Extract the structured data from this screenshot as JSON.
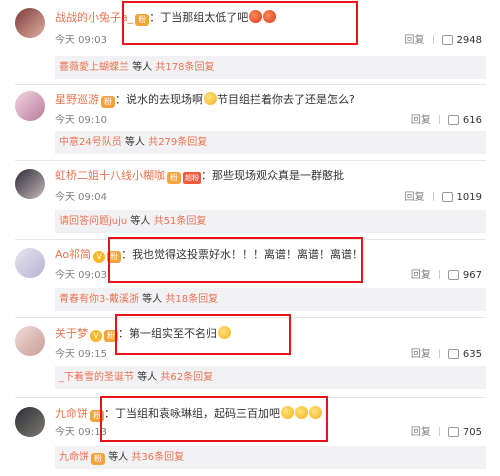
{
  "like_icon": "thumb-up-icon",
  "reply_label": "回复",
  "comments": [
    {
      "user": "战战的小兔子a_",
      "text": "丁当那组太低了吧",
      "emojis": 2,
      "time": "今天 09:03",
      "likes": "2948",
      "reply_users": "薔薇愛上蝴蝶兰",
      "reply_mid": "等人",
      "reply_count": "共178条回复"
    },
    {
      "user": "星野巡游",
      "text": "说水的去现场啊",
      "text2": "节目组拦着你去了还是怎么?",
      "time": "今天 09:10",
      "likes": "616",
      "reply_users": "中意24号队员",
      "reply_mid": "等人",
      "reply_count": "共279条回复"
    },
    {
      "user": "虹桥二姐十八线小糊咖",
      "vip": "超粉",
      "text": "那些现场观众真是一群憨批",
      "time": "今天 09:04",
      "likes": "1019",
      "reply_users": "请回答问题juju",
      "reply_mid": "等人",
      "reply_count": "共51条回复"
    },
    {
      "user": "Ao祁简",
      "text": "我也觉得这投票好水！！！离谱！离谱！离谱！",
      "time": "今天 09:03",
      "likes": "967",
      "reply_users": "青春有你3-戴溪浙",
      "reply_mid": "等人",
      "reply_count": "共18条回复"
    },
    {
      "user": "关于梦",
      "text": "第一组实至不名归",
      "time": "今天 09:15",
      "likes": "635",
      "reply_users": "_下着雪的圣诞节",
      "reply_mid": "等人",
      "reply_count": "共62条回复"
    },
    {
      "user": "九命饼",
      "text": "丁当组和袁咏琳组，起码三百加吧",
      "time": "今天 09:13",
      "likes": "705",
      "reply_users": "九命饼",
      "reply_mid": "等人",
      "reply_count": "共36条回复"
    }
  ]
}
